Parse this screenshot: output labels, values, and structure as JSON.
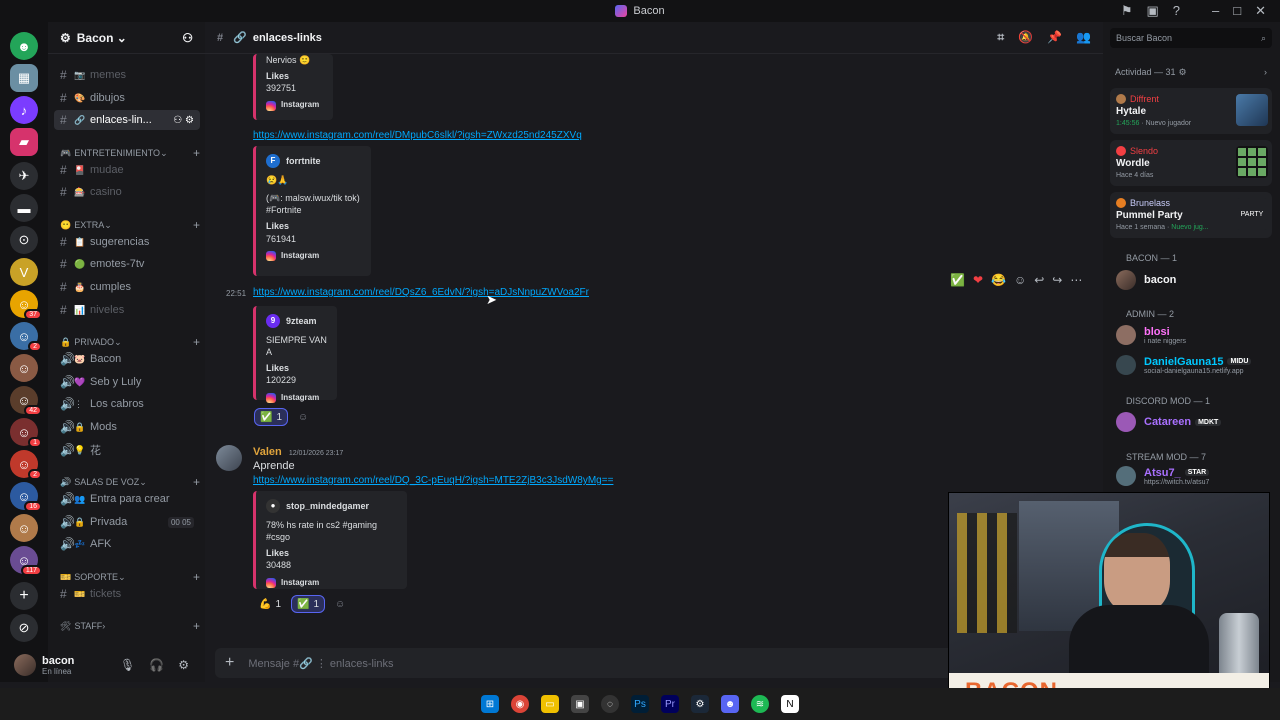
{
  "window": {
    "title": "Bacon"
  },
  "server": {
    "name": "Bacon",
    "channels": [
      {
        "label": "memes",
        "emoji": "📷",
        "muted": true
      },
      {
        "label": "dibujos",
        "emoji": "🎨",
        "muted": false
      },
      {
        "label": "enlaces-lin...",
        "emoji": "🔗",
        "muted": false,
        "selected": true
      }
    ],
    "cat_entretenimiento": "ENTRETENIMIENTO",
    "entretenimiento": [
      {
        "label": "mudae"
      },
      {
        "label": "casino"
      }
    ],
    "cat_extra": "EXTRA",
    "extra": [
      {
        "label": "sugerencias"
      },
      {
        "label": "emotes-7tv"
      },
      {
        "label": "cumples"
      },
      {
        "label": "niveles"
      }
    ],
    "cat_privado": "PRIVADO",
    "privado": [
      {
        "label": "Bacon"
      },
      {
        "label": "Seb y Luly"
      },
      {
        "label": "Los cabros"
      },
      {
        "label": "Mods"
      },
      {
        "label": "花"
      }
    ],
    "cat_voz": "SALAS DE VOZ",
    "voz": [
      {
        "label": "Entra para crear"
      },
      {
        "label": "Privada",
        "count_a": "00",
        "count_b": "05"
      },
      {
        "label": "AFK"
      }
    ],
    "cat_soporte": "SOPORTE",
    "soporte": [
      {
        "label": "tickets"
      }
    ],
    "cat_staff": "STAFF"
  },
  "user": {
    "name": "bacon",
    "status": "En línea"
  },
  "channel_header": {
    "name": "enlaces-links"
  },
  "messages": {
    "embed1": {
      "text": "Nervios 🙂",
      "likes_label": "Likes",
      "likes": "392751",
      "source": "Instagram"
    },
    "link1": "https://www.instagram.com/reel/DMpubC6slkl/?igsh=ZWxzd25nd245ZXVq",
    "embed2": {
      "author": "forrtnite",
      "line1": "😢🙏",
      "line2": "(🎮: malsw.iwux/tik tok)",
      "line3": "#Fortnite",
      "likes_label": "Likes",
      "likes": "761941",
      "source": "Instagram"
    },
    "time2": "22:51",
    "link2": "https://www.instagram.com/reel/DQsZ6_6EdvN/?igsh=aDJsNnpuZWVoa2Fr",
    "embed3": {
      "author": "9zteam",
      "line1": "SIEMPRE VAN A",
      "likes_label": "Likes",
      "likes": "120229",
      "source": "Instagram"
    },
    "reaction3_count": "1",
    "msg4": {
      "author": "Valen",
      "timestamp": "12/01/2026 23:17",
      "text": "Aprende"
    },
    "link4": "https://www.instagram.com/reel/DQ_3C-pEuqH/?igsh=MTE2ZjB3c3JsdW8yMg==",
    "embed4": {
      "author": "stop_mindedgamer",
      "line1": "78% hs rate in cs2 #gaming #csgo",
      "likes_label": "Likes",
      "likes": "30488",
      "source": "Instagram"
    },
    "reaction4a_count": "1",
    "reaction4b_count": "1"
  },
  "composer": {
    "placeholder": "Mensaje #🔗 ⋮ enlaces-links"
  },
  "search": {
    "placeholder": "Buscar Bacon"
  },
  "activity": {
    "title": "Actividad — 31",
    "items": [
      {
        "user": "Diffrent",
        "game": "Hytale",
        "status": "1:45:56",
        "extra": "Nuevo jugador",
        "user_color": "#f23f43"
      },
      {
        "user": "Slendo",
        "game": "Wordle",
        "status": "Hace 4 días",
        "extra": "",
        "user_color": "#f23f43"
      },
      {
        "user": "Brunelass",
        "game": "Pummel Party",
        "status": "Hace 1 semana",
        "extra": "Nuevo jug...",
        "user_color": "#c9cdfb"
      }
    ]
  },
  "members": {
    "group1": "BACON — 1",
    "m1": {
      "name": "bacon",
      "color": "#f2f3f5"
    },
    "group2": "ADMIN — 2",
    "m2": {
      "name": "blosi",
      "status": "i nate niggers",
      "color": "#ff73fa"
    },
    "m3": {
      "name": "DanielGauna15",
      "badge": "MIDU",
      "status": "social-danielgauna15.netlify.app",
      "color": "#00c8ff"
    },
    "group3": "Discord MOD — 1",
    "m4": {
      "name": "Catareen",
      "badge": "MDKT",
      "color": "#a970ff"
    },
    "group4": "Stream MOD — 7",
    "m5": {
      "name": "Atsu7_",
      "badge": "STAR",
      "status": "https://twitch.tv/atsu7",
      "color": "#a970ff"
    }
  },
  "webcam": {
    "brand": "BACON"
  }
}
